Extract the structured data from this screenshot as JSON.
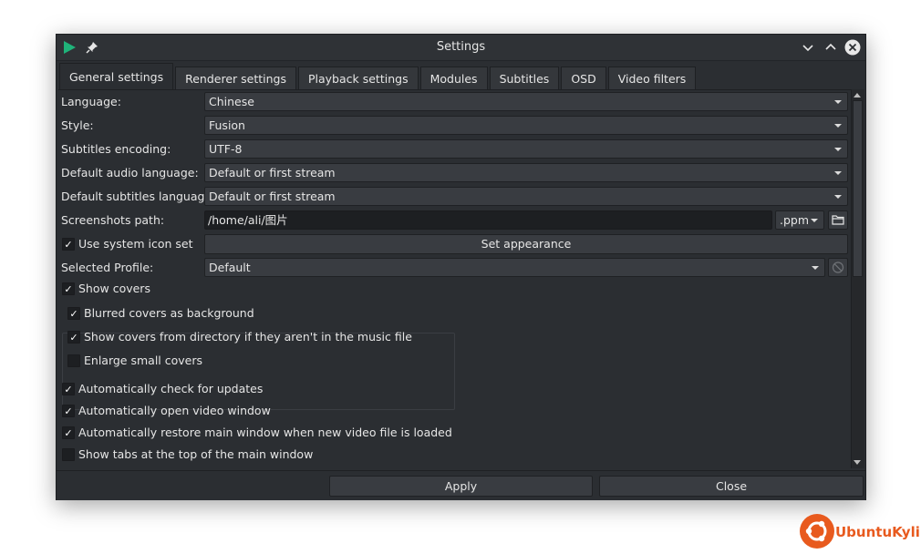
{
  "window": {
    "title": "Settings"
  },
  "tabs": [
    {
      "label": "General settings",
      "active": true
    },
    {
      "label": "Renderer settings"
    },
    {
      "label": "Playback settings"
    },
    {
      "label": "Modules"
    },
    {
      "label": "Subtitles"
    },
    {
      "label": "OSD"
    },
    {
      "label": "Video filters"
    }
  ],
  "general": {
    "language": {
      "label": "Language:",
      "value": "Chinese"
    },
    "style": {
      "label": "Style:",
      "value": "Fusion"
    },
    "subtitles_encoding": {
      "label": "Subtitles encoding:",
      "value": "UTF-8"
    },
    "default_audio_language": {
      "label": "Default audio language:",
      "value": "Default or first stream"
    },
    "default_subtitles_language": {
      "label": "Default subtitles language:",
      "value": "Default or first stream"
    },
    "screenshots_path": {
      "label": "Screenshots path:",
      "value": "/home/ali/图片",
      "format": ".ppm"
    },
    "use_system_icon_set": {
      "label": "Use system icon set",
      "checked": true
    },
    "set_appearance_label": "Set appearance",
    "selected_profile": {
      "label": "Selected Profile:",
      "value": "Default"
    },
    "show_covers": {
      "label": "Show covers",
      "checked": true
    },
    "blurred_covers": {
      "label": "Blurred covers as background",
      "checked": true
    },
    "covers_from_directory": {
      "label": "Show covers from directory if they aren't in the music file",
      "checked": true
    },
    "enlarge_small_covers": {
      "label": "Enlarge small covers",
      "checked": false
    },
    "auto_check_updates": {
      "label": "Automatically check for updates",
      "checked": true
    },
    "auto_open_video_window": {
      "label": "Automatically open video window",
      "checked": true
    },
    "auto_restore_main_window": {
      "label": "Automatically restore main window when new video file is loaded",
      "checked": true
    },
    "show_tabs_top": {
      "label": "Show tabs at the top of the main window",
      "checked": false
    }
  },
  "buttons": {
    "apply": "Apply",
    "close": "Close"
  },
  "watermark": {
    "text": "UbuntuKylin"
  },
  "colors": {
    "accent_green": "#1fb37a",
    "brand_orange": "#e85a1e"
  }
}
